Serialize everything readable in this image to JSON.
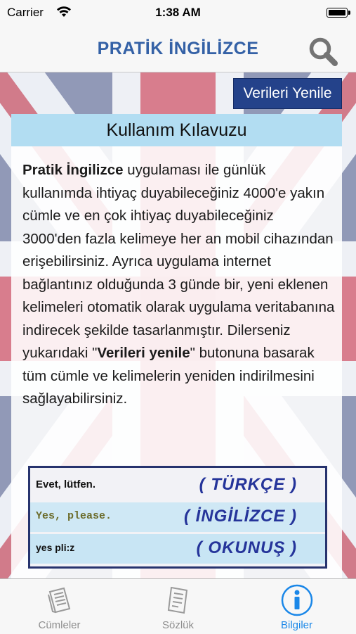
{
  "status_bar": {
    "carrier": "Carrier",
    "time": "1:38 AM"
  },
  "nav": {
    "title": "PRATİK İNGİLİZCE"
  },
  "refresh_button": {
    "label": "Verileri Yenile"
  },
  "guide": {
    "title": "Kullanım Kılavuzu",
    "app_name": "Pratik İngilizce",
    "text_1": " uygulaması ile günlük kullanımda ihtiyaç duyabileceğiniz 4000'e yakın cümle ve en çok ihtiyaç duyabileceğiniz 3000'den fazla kelimeye her an mobil cihazından erişebilirsiniz. Ayrıca uygulama internet bağlantınız olduğunda 3 günde bir, yeni eklenen kelimeleri otomatik olarak uygulama veritabanına indirecek şekilde tasarlanmıştır. Dilerseniz yukarıdaki \"",
    "button_ref": "Verileri yenile",
    "text_2": "\" butonuna basarak tüm cümle ve kelimelerin yeniden indirilmesini sağlayabilirsiniz."
  },
  "sample": {
    "rows": [
      {
        "text": "Evet, lütfen.",
        "label": "( TÜRKÇE )"
      },
      {
        "text": "Yes, please.",
        "label": "( İNGİLİZCE )"
      },
      {
        "text": "yes pli:z",
        "label": "( OKUNUŞ )"
      }
    ]
  },
  "tabs": [
    {
      "label": "Cümleler",
      "icon": "book-icon"
    },
    {
      "label": "Sözlük",
      "icon": "dictionary-icon"
    },
    {
      "label": "Bilgiler",
      "icon": "info-icon"
    }
  ],
  "colors": {
    "accent": "#1a87e8",
    "title": "#3461a6",
    "button": "#24428a",
    "panel_header": "#b2ddf2"
  }
}
